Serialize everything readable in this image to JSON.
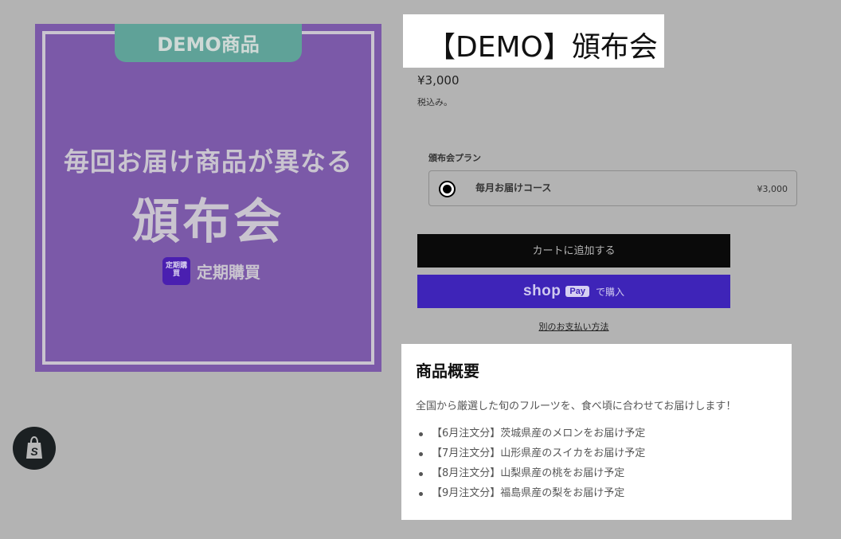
{
  "product_image": {
    "demo_tab": "DEMO商品",
    "line1": "毎回お届け商品が異なる",
    "line2": "頒布会",
    "brand_logo_text": "定期購買",
    "brand_name": "定期購買"
  },
  "product": {
    "title": "【DEMO】頒布会",
    "price": "¥3,000",
    "tax_note": "税込み。"
  },
  "plan": {
    "label": "頒布会プラン",
    "option_name": "毎月お届けコース",
    "option_price": "¥3,000",
    "selected": true
  },
  "actions": {
    "add_to_cart": "カートに追加する",
    "shop_pay_shop": "shop",
    "shop_pay_badge": "Pay",
    "shop_pay_buy": "で購入",
    "other_payment": "別のお支払い方法"
  },
  "description": {
    "title": "商品概要",
    "text": "全国から厳選した旬のフルーツを、食べ頃に合わせてお届けします！",
    "items": [
      "【6月注文分】茨城県産のメロンをお届け予定",
      "【7月注文分】山形県産のスイカをお届け予定",
      "【8月注文分】山梨県産の桃をお届け予定",
      "【9月注文分】福島県産の梨をお届け予定"
    ]
  },
  "icons": {
    "shopify_badge": "shopify-bag-icon",
    "radio": "radio-selected-icon"
  },
  "colors": {
    "overlay_bg": "#b3b3b3",
    "image_bg": "#7b59a8",
    "demo_tab": "#5fa298",
    "add_to_cart_bg": "#0a0a0a",
    "shop_pay_bg": "#3e24b8"
  }
}
